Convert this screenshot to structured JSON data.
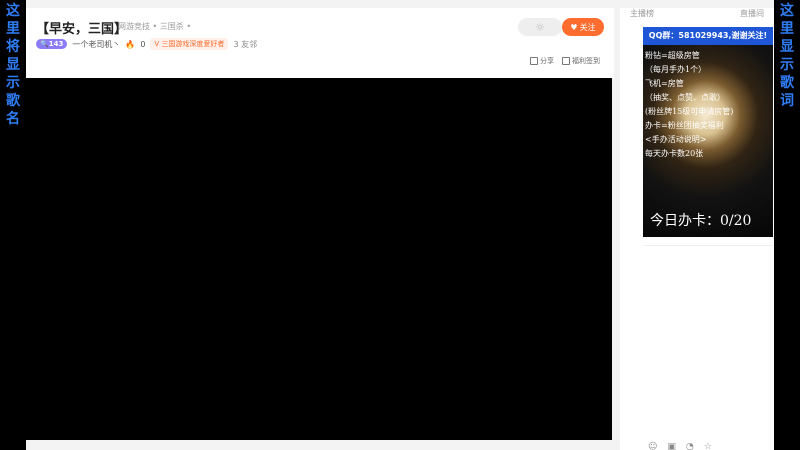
{
  "side": {
    "left_text": "这里将显示歌名",
    "right_text": "这里显示歌词"
  },
  "header": {
    "title": "【早安，三国】",
    "category": "网游竞技 • 三国杀 •",
    "follow_label": "关注",
    "streamer": "一个老司机丶",
    "level": "143",
    "hot_count": "0",
    "tag": "三国游戏深度爱好者",
    "fans": "3 友邻",
    "share": "分享",
    "sign": "福利签到"
  },
  "right": {
    "tab_left": "主播榜",
    "tab_right": "直播间",
    "qq": "QQ群：581029943,谢谢关注!",
    "lines": [
      "粉钻=超级房管",
      "（每月手办1个）",
      "飞机=房管",
      "（抽奖、点赞、点歌）",
      "(粉丝牌15级可申请房管)",
      "办卡=粉丝团抽奖福利",
      "<手办活动说明>",
      "每天办卡数20张"
    ],
    "today": "今日办卡：0/20"
  },
  "bottom_icons": [
    "☺",
    "▣",
    "◔",
    "☆"
  ]
}
